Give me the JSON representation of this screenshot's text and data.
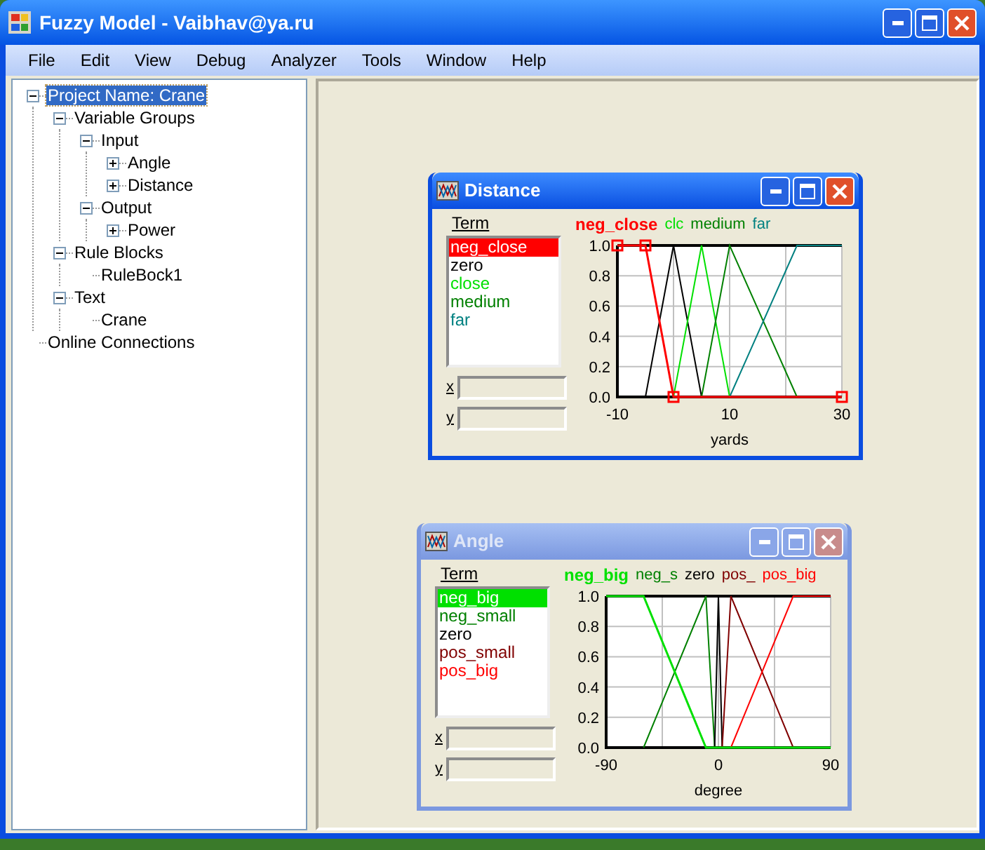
{
  "window": {
    "title": "Fuzzy Model - Vaibhav@ya.ru"
  },
  "menu": [
    "File",
    "Edit",
    "View",
    "Debug",
    "Analyzer",
    "Tools",
    "Window",
    "Help"
  ],
  "tree": [
    {
      "label": "Project Name: Crane",
      "selected": true,
      "expanded": true,
      "children": [
        {
          "label": "Variable Groups",
          "selected": false,
          "expanded": true,
          "children": [
            {
              "label": "Input",
              "selected": false,
              "expanded": true,
              "children": [
                {
                  "label": "Angle",
                  "selected": false,
                  "expanded": false
                },
                {
                  "label": "Distance",
                  "selected": false,
                  "expanded": false
                }
              ]
            },
            {
              "label": "Output",
              "selected": false,
              "expanded": true,
              "children": [
                {
                  "label": "Power",
                  "selected": false,
                  "expanded": false
                }
              ]
            }
          ]
        },
        {
          "label": "Rule Blocks",
          "selected": false,
          "expanded": true,
          "children": [
            {
              "label": "RuleBock1",
              "selected": false
            }
          ]
        },
        {
          "label": "Text",
          "selected": false,
          "expanded": true,
          "children": [
            {
              "label": "Crane",
              "selected": false
            }
          ]
        }
      ]
    },
    {
      "label": "Online Connections",
      "selected": false
    }
  ],
  "child_windows": [
    {
      "title": "Distance",
      "active": true,
      "term_label": "Term",
      "x_label": "x",
      "y_label": "y",
      "terms": [
        {
          "selected": true
        },
        {
          "selected": false
        },
        {
          "selected": false
        },
        {
          "selected": false
        },
        {
          "selected": false
        }
      ],
      "legend": [
        {
          "text": "neg_close",
          "color": "#ff0000",
          "selected": true
        },
        {
          "text": "clc",
          "color": "#00e000",
          "selected": false
        },
        {
          "text": "medium",
          "color": "#008000",
          "selected": false
        },
        {
          "text": "far",
          "color": "#008080",
          "selected": false
        }
      ],
      "chart_data": {
        "type": "line",
        "xlabel": "yards",
        "grid": true,
        "x": [
          -10,
          -5,
          0,
          5,
          10,
          22,
          30
        ],
        "series": [
          {
            "name": "neg_close",
            "color": "#ff0000",
            "values": [
              1,
              1,
              0,
              0,
              0,
              0,
              0
            ]
          },
          {
            "name": "zero",
            "color": "#000000",
            "values": [
              null,
              0,
              1,
              0,
              null,
              null,
              null
            ]
          },
          {
            "name": "close",
            "color": "#00e000",
            "values": [
              null,
              null,
              0,
              1,
              0,
              null,
              null
            ]
          },
          {
            "name": "medium",
            "color": "#008000",
            "values": [
              null,
              null,
              null,
              0,
              1,
              0,
              null
            ]
          },
          {
            "name": "far",
            "color": "#008080",
            "values": [
              null,
              null,
              null,
              null,
              0,
              1,
              1
            ]
          }
        ],
        "xlim": [
          -10,
          30
        ],
        "ylim": [
          0,
          1
        ],
        "xticks": [
          -10,
          10,
          30
        ],
        "yticks": [
          {
            "value": 0,
            "label": "0.0"
          },
          {
            "value": 0.2,
            "label": "0.2"
          },
          {
            "value": 0.4,
            "label": "0.4"
          },
          {
            "value": 0.6,
            "label": "0.6"
          },
          {
            "value": 0.8,
            "label": "0.8"
          },
          {
            "value": 1,
            "label": "1.0"
          }
        ]
      }
    },
    {
      "title": "Angle",
      "active": false,
      "term_label": "Term",
      "x_label": "x",
      "y_label": "y",
      "terms": [
        {
          "selected": true
        },
        {
          "selected": false
        },
        {
          "selected": false
        },
        {
          "selected": false
        },
        {
          "selected": false
        }
      ],
      "legend": [
        {
          "text": "neg_big",
          "color": "#00e000",
          "selected": true
        },
        {
          "text": "neg_s",
          "color": "#008000",
          "selected": false
        },
        {
          "text": "zero",
          "color": "#000000",
          "selected": false
        },
        {
          "text": "pos_",
          "color": "#800000",
          "selected": false
        },
        {
          "text": "pos_big",
          "color": "#ff0000",
          "selected": false
        }
      ],
      "chart_data": {
        "type": "line",
        "xlabel": "degree",
        "grid": true,
        "x": [
          -90,
          -60,
          -10,
          -3,
          0,
          3,
          10,
          60,
          90
        ],
        "series": [
          {
            "name": "neg_big",
            "color": "#00e000",
            "values": [
              1,
              1,
              0,
              0,
              0,
              0,
              0,
              0,
              0
            ]
          },
          {
            "name": "neg_small",
            "color": "#008000",
            "values": [
              null,
              0,
              1,
              0,
              null,
              null,
              null,
              null,
              null
            ]
          },
          {
            "name": "zero",
            "color": "#000000",
            "values": [
              null,
              null,
              null,
              0,
              1,
              0,
              null,
              null,
              null
            ]
          },
          {
            "name": "pos_small",
            "color": "#800000",
            "values": [
              null,
              null,
              null,
              null,
              null,
              0,
              1,
              0,
              null
            ]
          },
          {
            "name": "pos_big",
            "color": "#ff0000",
            "values": [
              null,
              null,
              null,
              null,
              null,
              null,
              0,
              1,
              1
            ]
          }
        ],
        "xlim": [
          -90,
          90
        ],
        "ylim": [
          0,
          1
        ],
        "xticks": [
          -90,
          0,
          90
        ],
        "yticks": [
          {
            "value": 0,
            "label": "0.0"
          },
          {
            "value": 0.2,
            "label": "0.2"
          },
          {
            "value": 0.4,
            "label": "0.4"
          },
          {
            "value": 0.6,
            "label": "0.6"
          },
          {
            "value": 0.8,
            "label": "0.8"
          },
          {
            "value": 1,
            "label": "1.0"
          }
        ]
      }
    }
  ]
}
